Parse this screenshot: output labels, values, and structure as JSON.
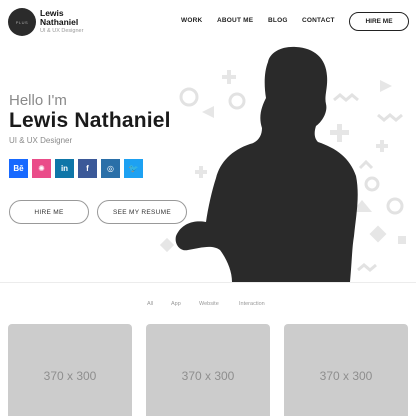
{
  "brand": {
    "logo_text": "PLUS",
    "name": "Lewis Nathaniel",
    "subtitle": "UI & UX Designer"
  },
  "nav": {
    "items": [
      {
        "label": "WORK"
      },
      {
        "label": "ABOUT ME"
      },
      {
        "label": "BLOG"
      },
      {
        "label": "CONTACT"
      }
    ],
    "hire_label": "HIRE ME"
  },
  "hero": {
    "greeting": "Hello I'm",
    "name": "Lewis Nathaniel",
    "role": "UI & UX Designer",
    "socials": [
      {
        "icon": "behance-icon",
        "glyph": "Bē",
        "color": "#1769ff"
      },
      {
        "icon": "dribbble-icon",
        "glyph": "✺",
        "color": "#ea4c89"
      },
      {
        "icon": "linkedin-icon",
        "glyph": "in",
        "color": "#0e76a8"
      },
      {
        "icon": "facebook-icon",
        "glyph": "f",
        "color": "#3b5998"
      },
      {
        "icon": "instagram-icon",
        "glyph": "◎",
        "color": "#2a6fa8"
      },
      {
        "icon": "twitter-icon",
        "glyph": "🐦",
        "color": "#1da1f2"
      }
    ],
    "hire_button": "HIRE ME",
    "resume_button": "SEE MY RESUME"
  },
  "filters": [
    "All",
    "App",
    "Website",
    "Interaction"
  ],
  "portfolio": [
    {
      "label": "370 x 300"
    },
    {
      "label": "370 x 300"
    },
    {
      "label": "370 x 300"
    }
  ],
  "colors": {
    "silhouette": "#2a2a2a",
    "decor": "#e3e3e3",
    "card": "#cccccc"
  }
}
